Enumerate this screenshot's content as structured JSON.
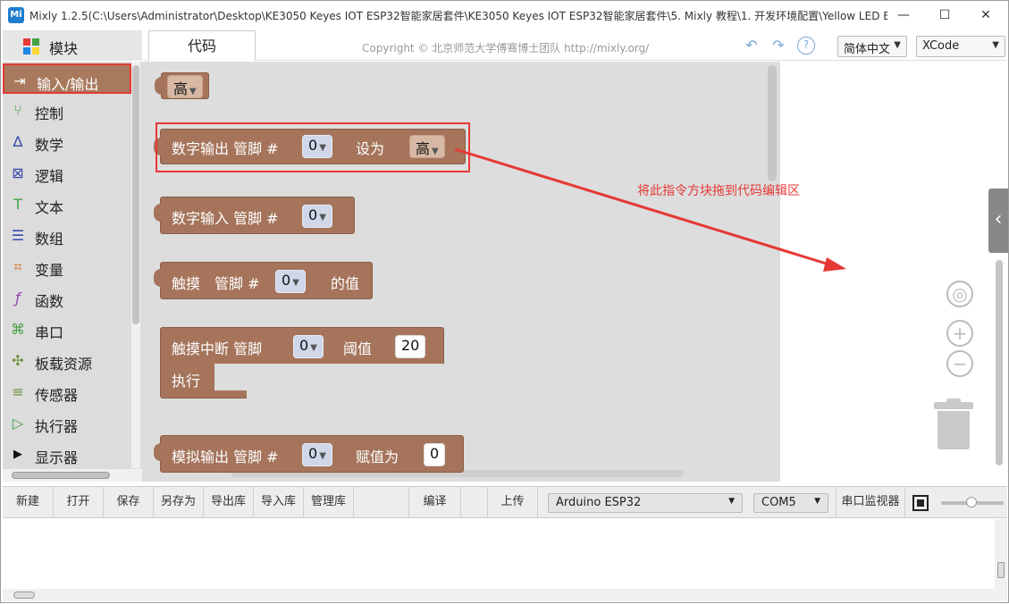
{
  "window": {
    "title": "Mixly 1.2.5(C:\\Users\\Administrator\\Desktop\\KE3050 Keyes IOT ESP32智能家居套件\\KE3050 Keyes IOT ESP32智能家居套件\\5. Mixly 教程\\1. 开发环境配置\\Yellow LED Bl...",
    "app_icon": "Mi",
    "minimize": "—",
    "maximize": "☐",
    "close": "✕"
  },
  "toolbox": {
    "header": "模块",
    "categories": [
      {
        "label": "输入/输出",
        "icon": "io-icon",
        "glyph": "⇥"
      },
      {
        "label": "控制",
        "icon": "control-icon",
        "glyph": "⑂"
      },
      {
        "label": "数学",
        "icon": "math-icon",
        "glyph": "∆"
      },
      {
        "label": "逻辑",
        "icon": "logic-icon",
        "glyph": "⊠"
      },
      {
        "label": "文本",
        "icon": "text-icon",
        "glyph": "T"
      },
      {
        "label": "数组",
        "icon": "array-icon",
        "glyph": "☰"
      },
      {
        "label": "变量",
        "icon": "variable-icon",
        "glyph": "⌗"
      },
      {
        "label": "函数",
        "icon": "function-icon",
        "glyph": "ƒ"
      },
      {
        "label": "串口",
        "icon": "serial-icon",
        "glyph": "⌘"
      },
      {
        "label": "板载资源",
        "icon": "board-resource-icon",
        "glyph": "✣"
      },
      {
        "label": "传感器",
        "icon": "sensor-icon",
        "glyph": "≡"
      },
      {
        "label": "执行器",
        "icon": "actuator-icon",
        "glyph": "▷"
      },
      {
        "label": "显示器",
        "icon": "display-icon",
        "glyph": "▶"
      }
    ]
  },
  "tabbar": {
    "code_tab": "代码",
    "copyright": "Copyright © 北京师范大学傅骞博士团队 http://mixly.org/",
    "undo": "↶",
    "redo": "↷",
    "help": "?",
    "language": "简体中文",
    "theme": "XCode"
  },
  "blocks": {
    "high_value": "高",
    "digital_write": {
      "label": "数字输出 管脚 #",
      "pin": "0",
      "set_label": "设为",
      "value": "高"
    },
    "digital_read": {
      "label": "数字输入 管脚 #",
      "pin": "0"
    },
    "touch_read": {
      "label": "触摸",
      "pin_label": "管脚 #",
      "pin": "0",
      "suffix": "的值"
    },
    "touch_interrupt": {
      "label": "触摸中断 管脚",
      "pin": "0",
      "threshold_label": "阈值",
      "threshold": "20",
      "do_label": "执行"
    },
    "analog_write": {
      "label": "模拟输出 管脚 #",
      "pin": "0",
      "assign_label": "赋值为",
      "value": "0"
    }
  },
  "annotation": "将此指令方块拖到代码编辑区",
  "workspace": {
    "center": "◎",
    "zoom_in": "+",
    "zoom_out": "−",
    "collapse": "‹"
  },
  "bottombar": {
    "buttons": [
      "新建",
      "打开",
      "保存",
      "另存为",
      "导出库",
      "导入库",
      "管理库"
    ],
    "compile": "编译",
    "upload": "上传",
    "board": "Arduino ESP32",
    "port": "COM5",
    "serial_monitor": "串口监视器"
  },
  "colors": {
    "block": "#a5745b",
    "selected_category": "#a8795c",
    "highlight": "#e53935"
  }
}
